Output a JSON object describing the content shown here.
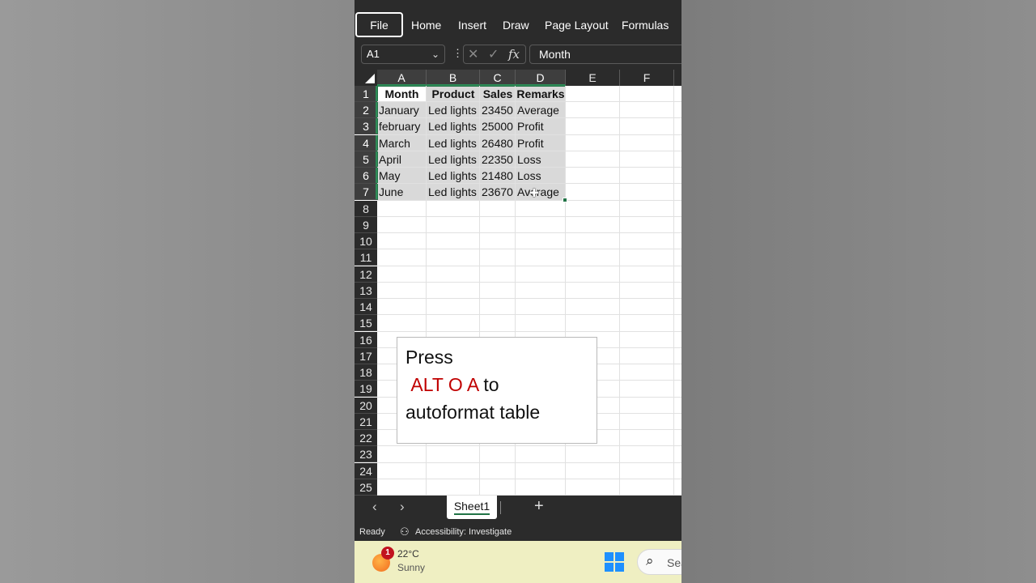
{
  "ribbon": {
    "tabs": [
      "File",
      "Home",
      "Insert",
      "Draw",
      "Page Layout",
      "Formulas"
    ]
  },
  "formula_bar": {
    "name_box": "A1",
    "fx": "fx",
    "value": "Month"
  },
  "columns": [
    "A",
    "B",
    "C",
    "D",
    "E",
    "F"
  ],
  "rows": [
    "1",
    "2",
    "3",
    "4",
    "5",
    "6",
    "7",
    "8",
    "9",
    "10",
    "11",
    "12",
    "13",
    "14",
    "15",
    "16",
    "17",
    "18",
    "19",
    "20",
    "21",
    "22",
    "23",
    "24",
    "25"
  ],
  "table": {
    "headers": [
      "Month",
      "Product",
      "Sales",
      "Remarks"
    ],
    "data": [
      [
        "January",
        "Led lights",
        "23450",
        "Average"
      ],
      [
        "february",
        "Led lights",
        "25000",
        "Profit"
      ],
      [
        "March",
        "Led lights",
        "26480",
        "Profit"
      ],
      [
        "April",
        "Led lights",
        "22350",
        "Loss"
      ],
      [
        "May",
        "Led lights",
        "21480",
        "Loss"
      ],
      [
        "June",
        "Led lights",
        "23670",
        "Average"
      ]
    ]
  },
  "tip": {
    "line1": "Press",
    "keys": "ALT O A",
    "to": " to",
    "line3": "autoformat table"
  },
  "sheets": {
    "active": "Sheet1"
  },
  "status": {
    "ready": "Ready",
    "accessibility": "Accessibility: Investigate"
  },
  "taskbar": {
    "badge": "1",
    "temperature": "22°C",
    "condition": "Sunny",
    "search_placeholder": "Sea"
  },
  "colors": {
    "accent": "#217346",
    "tip_keys": "#c00000",
    "taskbar": "#efefc2"
  }
}
